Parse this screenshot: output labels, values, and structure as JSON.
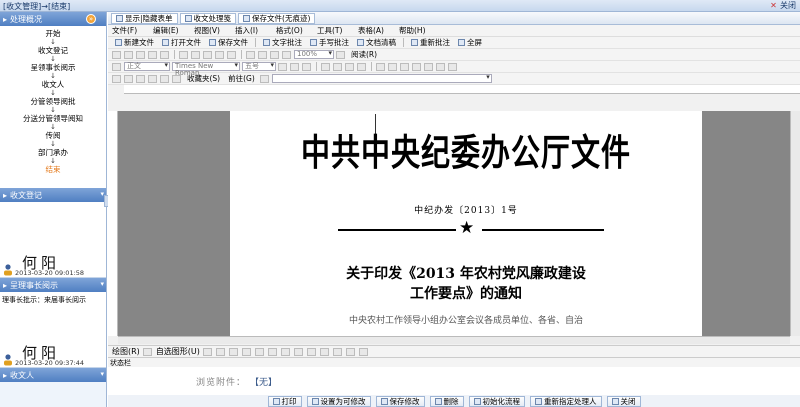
{
  "window": {
    "title": "[收文管理]→[结束]",
    "close_label": "关闭"
  },
  "sidebar": {
    "flow_panel_title": "处理概况",
    "flow_steps": [
      "开始",
      "收文登记",
      "呈领事长阅示",
      "收文人",
      "分管领导阅批",
      "分送分管领导阅知",
      "传阅",
      "部门承办",
      "结束"
    ],
    "sections": [
      {
        "title": "收文登记",
        "note": "",
        "signature": "何阳",
        "time": "2013-03-20 09:01:58"
      },
      {
        "title": "呈理事长阅示",
        "note": "理事长批示：来届事长阅示",
        "signature": "何阳",
        "time": "2013-03-20 09:37:44"
      },
      {
        "title": "收文人"
      }
    ]
  },
  "tabs": [
    {
      "label": "显示|隐藏表单",
      "icon": "form-icon"
    },
    {
      "label": "收文处理笺",
      "icon": "document-icon"
    },
    {
      "label": "保存文件(无痕迹)",
      "icon": "save-icon"
    }
  ],
  "menu": [
    "文件(F)",
    "编辑(E)",
    "视图(V)",
    "插入(I)",
    "格式(O)",
    "工具(T)",
    "表格(A)",
    "帮助(H)"
  ],
  "toolbar1": [
    "新建文件",
    "打开文件",
    "保存文件",
    "文字批注",
    "手写批注",
    "文档清稿",
    "重新批注",
    "全屏"
  ],
  "toolbar2": {
    "zoom": "100%",
    "read_label": "阅读(R)"
  },
  "toolbar3": {
    "style": "正文",
    "font": "Times New Roman",
    "size": "五号"
  },
  "toolbar4": {
    "favorites": "收藏夹(S)",
    "goto": "前往(G)"
  },
  "document": {
    "title": "中共中央纪委办公厅文件",
    "number": "中纪办发〔2013〕1号",
    "subtitle_line1": "关于印发《2013 年农村党风廉政建设",
    "subtitle_line2": "工作要点》的通知",
    "body_preview": "中央农村工作领导小组办公室会议各成员单位、各省、自治"
  },
  "drawbar": {
    "draw_label": "绘图(R)",
    "autoshape_label": "自选图形(U)"
  },
  "status_label": "状态栏",
  "attachment": {
    "label": "浏览附件：",
    "value": "【无】"
  },
  "actions": [
    "打印",
    "设置为可修改",
    "保存修改",
    "删除",
    "初始化流程",
    "重新指定处理人",
    "关闭"
  ],
  "colors": {
    "accent": "#4f7fc2",
    "active_step": "#e47a1c"
  }
}
